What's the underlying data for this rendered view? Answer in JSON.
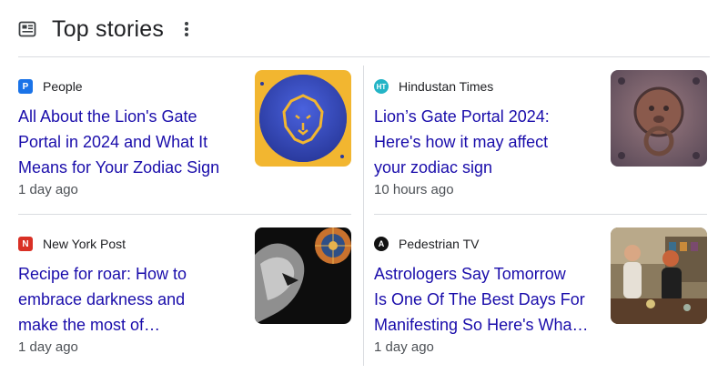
{
  "header": {
    "title": "Top stories",
    "icon": "newspaper-icon",
    "more_icon": "more-vert-icon"
  },
  "colors": {
    "link": "#1a0dab",
    "text": "#202124",
    "muted": "#4d5156",
    "divider": "#dadce0"
  },
  "stories": [
    {
      "source": "People",
      "source_logo_letter": "P",
      "source_logo_color": "#1a73e8",
      "headline_lines": [
        "All About the Lion's Gate",
        "Portal in 2024 and What It",
        "Means for Your Zodiac Sign"
      ],
      "time": "1 day ago",
      "thumb": "lion-logo-thumbnail"
    },
    {
      "source": "Hindustan Times",
      "source_logo_letter": "HT",
      "source_logo_color": "#23b4c6",
      "headline_lines": [
        "Lion’s Gate Portal 2024:",
        "Here's how it may affect",
        "your zodiac sign"
      ],
      "time": "10 hours ago",
      "thumb": "lion-door-knocker-thumbnail"
    },
    {
      "source": "New York Post",
      "source_logo_letter": "N",
      "source_logo_color": "#d93025",
      "headline_lines": [
        "Recipe for roar: How to",
        "embrace darkness and",
        "make the most of…"
      ],
      "time": "1 day ago",
      "thumb": "roaring-lion-thumbnail"
    },
    {
      "source": "Pedestrian TV",
      "source_logo_letter": "A",
      "source_logo_color": "#111111",
      "headline_lines": [
        "Astrologers Say Tomorrow",
        "Is One Of The Best Days For",
        "Manifesting So Here's Wha…"
      ],
      "time": "1 day ago",
      "thumb": "people-shop-thumbnail"
    }
  ]
}
